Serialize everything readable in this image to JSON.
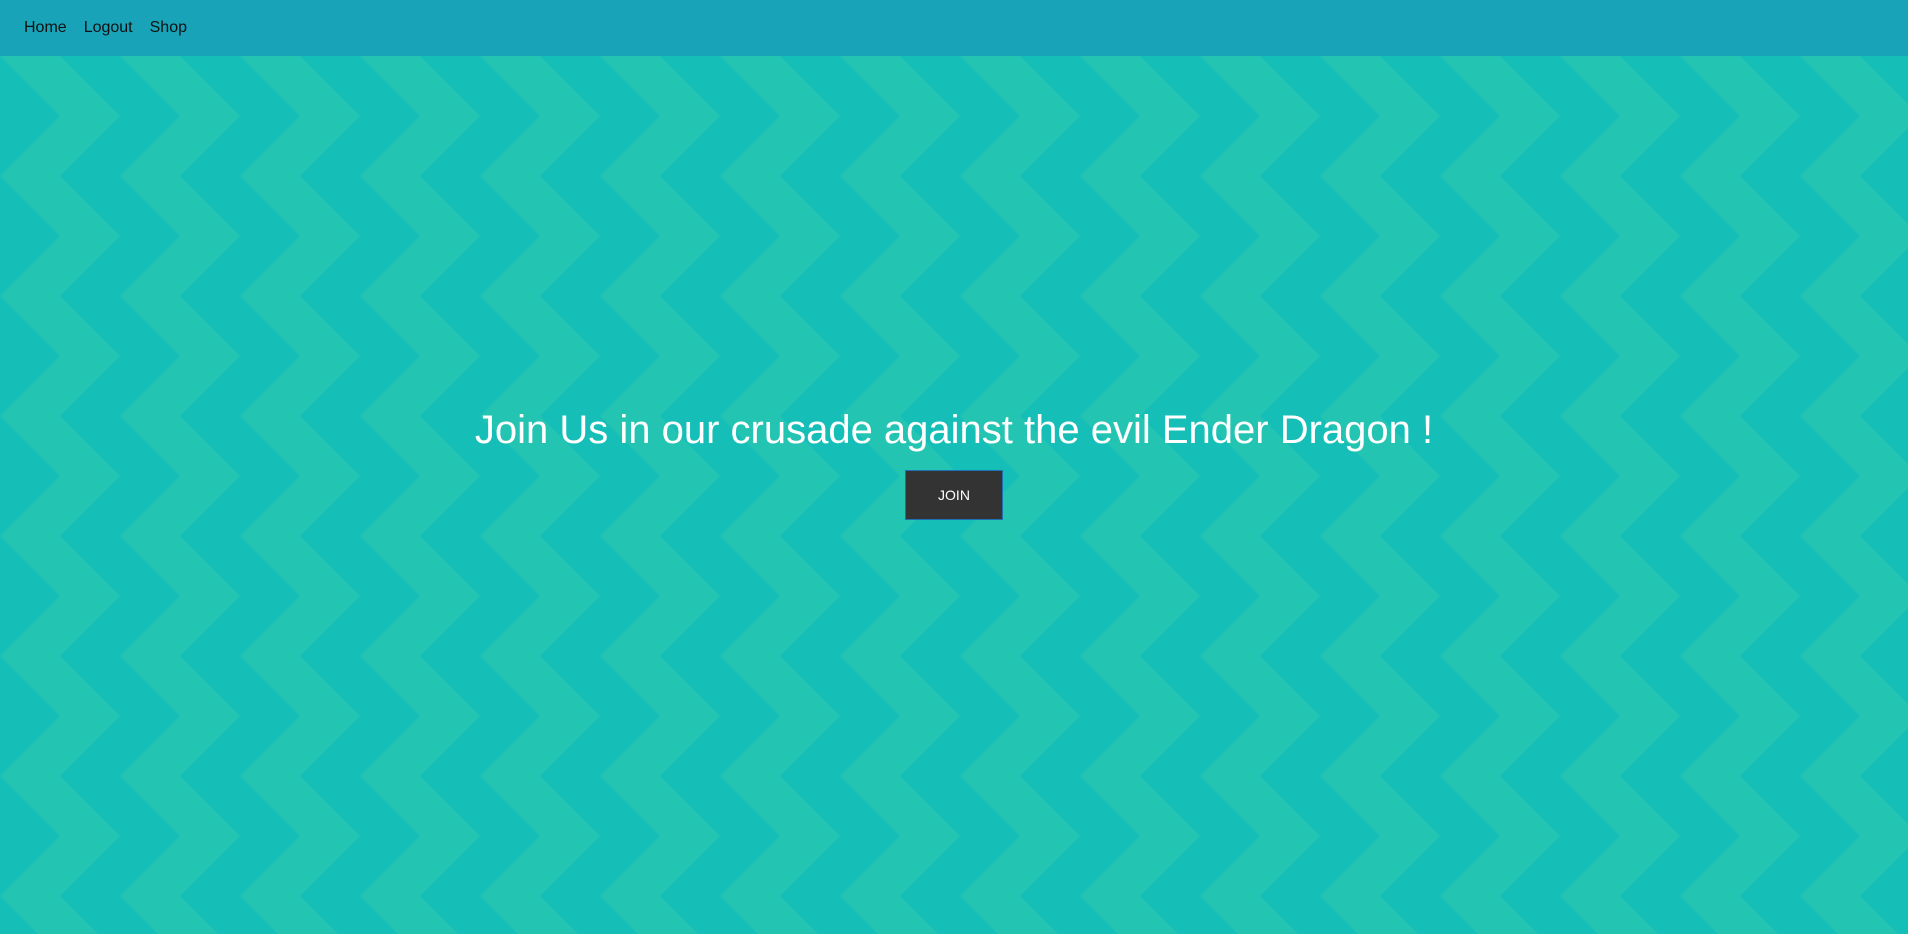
{
  "nav": {
    "items": [
      {
        "label": "Home"
      },
      {
        "label": "Logout"
      },
      {
        "label": "Shop"
      }
    ]
  },
  "hero": {
    "headline": "Join Us in our crusade against the evil Ender Dragon !",
    "button_label": "JOIN"
  },
  "colors": {
    "navbar": "#18a3b9",
    "pattern_dark": "#15bfb8",
    "pattern_light": "#24c4b2",
    "button": "#333333",
    "button_border": "#1f6fb5"
  }
}
